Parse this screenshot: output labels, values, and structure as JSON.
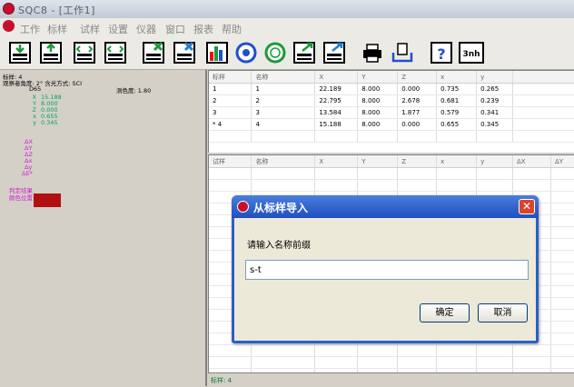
{
  "window": {
    "title": "SQC8 - [工作1]"
  },
  "menu": [
    "工作",
    "标样",
    "试样",
    "设置",
    "仪器",
    "窗口",
    "报表",
    "帮助"
  ],
  "toolbar": [
    {
      "icon": "import-down-icon"
    },
    {
      "icon": "import-up-icon"
    },
    {
      "icon": "list-compare-icon"
    },
    {
      "icon": "list-compare-alt-icon"
    },
    {
      "icon": "delete-sample-icon"
    },
    {
      "icon": "delete-standard-icon"
    },
    {
      "icon": "bar-chart-icon"
    },
    {
      "icon": "target-blue-icon"
    },
    {
      "icon": "target-green-icon"
    },
    {
      "icon": "export-icon"
    },
    {
      "icon": "export-alt-icon"
    },
    {
      "icon": "print-icon"
    },
    {
      "icon": "print-preview-icon"
    },
    {
      "icon": "help-icon"
    },
    {
      "icon": "3nh-icon"
    }
  ],
  "left_panel": {
    "std_line": "标样: 4",
    "obs_line": "观察者角度: 2°   含光方式: SCI",
    "illuminant": "D65",
    "measure_label": "测色度: 1.80",
    "values": [
      {
        "label": "X",
        "value": "15.188"
      },
      {
        "label": "Y",
        "value": "8.000"
      },
      {
        "label": "Z",
        "value": "0.000"
      },
      {
        "label": "x",
        "value": "0.655"
      },
      {
        "label": "y",
        "value": "0.345"
      }
    ],
    "deltas": [
      "ΔX",
      "ΔY",
      "ΔZ",
      "Δx",
      "Δy",
      "ΔE*"
    ],
    "judge_label": "判定结果",
    "color_label": "颜色位置",
    "swatch_color": "#b01010"
  },
  "std_table": {
    "headers": [
      "标样",
      "名称",
      "X",
      "Y",
      "Z",
      "x",
      "y"
    ],
    "rows": [
      [
        "1",
        "1",
        "22.189",
        "8.000",
        "0.000",
        "0.735",
        "0.265"
      ],
      [
        "2",
        "2",
        "22.795",
        "8.000",
        "2.678",
        "0.681",
        "0.239"
      ],
      [
        "3",
        "3",
        "13.584",
        "8.000",
        "1.877",
        "0.579",
        "0.341"
      ],
      [
        "* 4",
        "4",
        "15.188",
        "8.000",
        "0.000",
        "0.655",
        "0.345"
      ]
    ]
  },
  "sample_table": {
    "headers": [
      "试样",
      "名称",
      "X",
      "Y",
      "Z",
      "x",
      "y",
      "ΔX",
      "ΔY"
    ]
  },
  "status": {
    "text": "标样: 4"
  },
  "dialog": {
    "title": "从标样导入",
    "prompt": "请输入名称前缀",
    "input_value": "s-t",
    "ok": "确定",
    "cancel": "取消",
    "close": "✕"
  }
}
